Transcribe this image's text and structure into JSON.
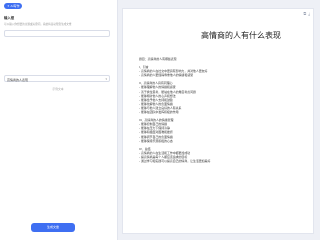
{
  "left": {
    "badge": "AI写作",
    "input_label": "输入框",
    "hint": "可以输入你想要的主题或关键词，系统将自动帮您生成文章",
    "select_value": "高情商的人表现",
    "example_text": "示例文本"
  },
  "actions": {
    "generate": "生成文章"
  },
  "doc": {
    "title": "高情商的人有什么表现",
    "lines": [
      "题目：高情商的人有哪些表现",
      "",
      "I、引言",
      "- 高情商的人在社交中更具有影响力，并对他人更友好",
      "- 高情商的人更懂得尊重他人的情绪和感受",
      "",
      "II、高情商的人具有同理心",
      "- 能够理解他人的情绪和感受",
      "- 善于换位思考，能站在他人的角度考虑问题",
      "- 能够倾听他人的心声和想法",
      "- 能够给予他人支持和鼓励",
      "- 能够化解他人的负面情绪",
      "- 能够与他人建立良好的人际关系",
      "- 能够在团队中发挥积极的作用",
      "",
      "III、高情商的人的情绪管理",
      "- 能够控制自己的情绪",
      "- 能够在压力下保持冷静",
      "- 能够积极面对困难和挫折",
      "- 能够调节自己的负面情绪",
      "- 能够保持乐观积极的心态",
      "",
      "IV、总结",
      "- 高情商的人在生活和工作中都更加成功",
      "- 提高情商是每个人都应该追求的目标",
      "- 通过学习和实践可以提高自己的情商，让生活更加美好"
    ]
  }
}
